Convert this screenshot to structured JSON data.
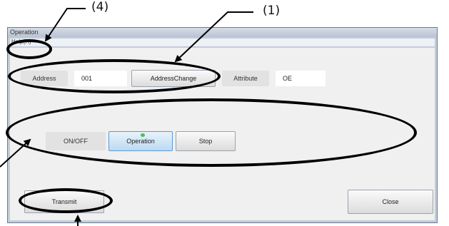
{
  "callouts": {
    "c4": "(4)",
    "c1": "(1)"
  },
  "window": {
    "title": "Operation",
    "menu": "Help(H)",
    "address_label": "Address",
    "address_value": "001",
    "address_change_button": "AddressChange",
    "attribute_label": "Attribute",
    "attribute_value": "OE",
    "onoff_label": "ON/OFF",
    "operation_button": "Operation",
    "stop_button": "Stop",
    "transmit_button": "Transmit",
    "close_button": "Close"
  },
  "colors": {
    "window_frame": "#c3ccd9",
    "client_bg": "#f0f0f0",
    "operation_highlight": "#bcdaf2",
    "led_green": "#4fbf4f",
    "annotation": "#000000"
  }
}
